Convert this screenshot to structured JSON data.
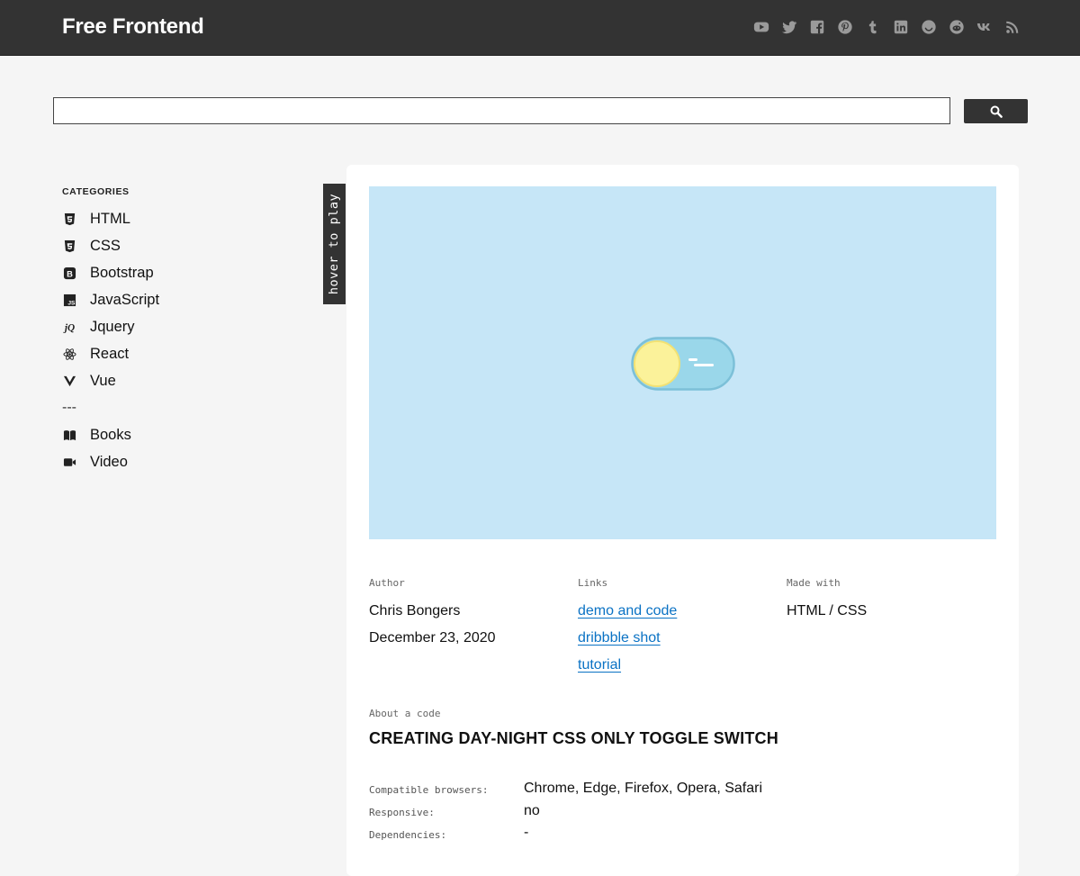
{
  "header": {
    "logo": "Free Frontend",
    "social": [
      "youtube-icon",
      "twitter-icon",
      "facebook-icon",
      "pinterest-icon",
      "tumblr-icon",
      "linkedin-icon",
      "smiley-icon",
      "reddit-icon",
      "vk-icon",
      "rss-icon"
    ]
  },
  "search": {
    "value": "",
    "placeholder": ""
  },
  "sidebar": {
    "heading": "CATEGORIES",
    "items": [
      {
        "label": "HTML",
        "icon": "html5-icon"
      },
      {
        "label": "CSS",
        "icon": "css3-icon"
      },
      {
        "label": "Bootstrap",
        "icon": "bootstrap-icon"
      },
      {
        "label": "JavaScript",
        "icon": "javascript-icon"
      },
      {
        "label": "Jquery",
        "icon": "jquery-icon"
      },
      {
        "label": "React",
        "icon": "react-icon"
      },
      {
        "label": "Vue",
        "icon": "vue-icon"
      }
    ],
    "separator": "---",
    "extra": [
      {
        "label": "Books",
        "icon": "book-icon"
      },
      {
        "label": "Video",
        "icon": "video-icon"
      }
    ]
  },
  "hover_tab": "hover to play",
  "meta": {
    "author_label": "Author",
    "author": "Chris Bongers",
    "date": "December 23, 2020",
    "links_label": "Links",
    "links": [
      "demo and code",
      "dribbble shot",
      "tutorial"
    ],
    "made_with_label": "Made with",
    "made_with": "HTML / CSS"
  },
  "about": {
    "label": "About a code",
    "title": "CREATING DAY-NIGHT CSS ONLY TOGGLE SWITCH"
  },
  "specs": {
    "browsers_label": "Compatible browsers:",
    "browsers": "Chrome, Edge, Firefox, Opera, Safari",
    "responsive_label": "Responsive:",
    "responsive": "no",
    "dependencies_label": "Dependencies:",
    "dependencies": "-"
  },
  "colors": {
    "topbar": "#333333",
    "preview_bg": "#c6e6f7",
    "toggle_track": "#9ad7ea",
    "sun": "#fbf29a",
    "link": "#0a72c4"
  }
}
